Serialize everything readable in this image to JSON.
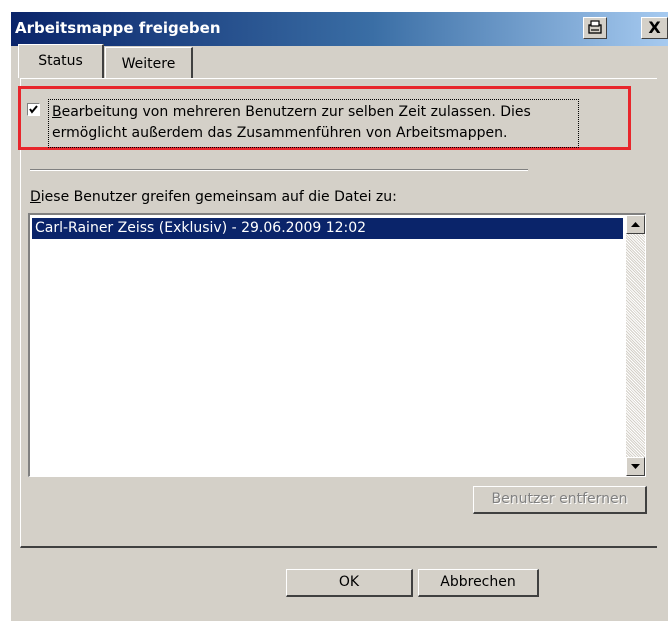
{
  "window": {
    "title": "Arbeitsmappe freigeben",
    "close_glyph": "X"
  },
  "tabs": [
    {
      "label": "Status",
      "active": true
    },
    {
      "label": "Weitere",
      "active": false
    }
  ],
  "share_option": {
    "checked": true,
    "label_mnemonic": "B",
    "label_rest": "earbeitung von mehreren Benutzern zur selben Zeit zulassen. Dies ermöglicht außerdem das Zusammenführen von Arbeitsmappen."
  },
  "users_section": {
    "label_mnemonic": "D",
    "label_rest": "iese Benutzer greifen gemeinsam auf die Datei zu:",
    "users": [
      "Carl-Rainer Zeiss (Exklusiv) - 29.06.2009 12:02"
    ]
  },
  "buttons": {
    "remove": "Benutzer entfernen",
    "ok": "OK",
    "cancel": "Abbrechen"
  },
  "colors": {
    "highlight": "#e8262c",
    "selection": "#0a246a",
    "titlebar_start": "#0a246a",
    "titlebar_end": "#a6caf0"
  },
  "icons": [
    "help-icon",
    "close-icon",
    "checkmark-icon",
    "scroll-up-icon",
    "scroll-down-icon"
  ]
}
